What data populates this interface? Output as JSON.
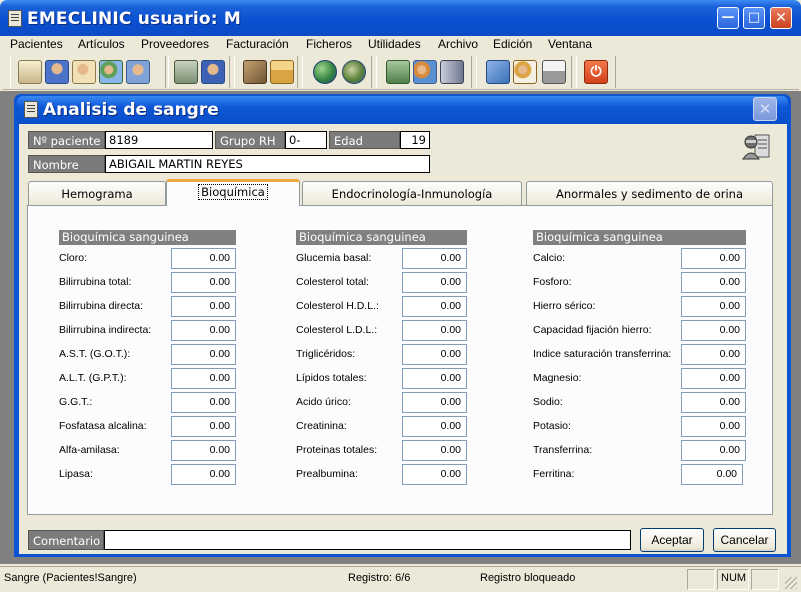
{
  "app": {
    "title": "EMECLINIC usuario: M"
  },
  "menu": [
    "Pacientes",
    "Artículos",
    "Proveedores",
    "Facturación",
    "Ficheros",
    "Utilidades",
    "Archivo",
    "Edición",
    "Ventana"
  ],
  "toolbar_icons": [
    "calendar-icon",
    "patient-icon",
    "patient-card-icon",
    "patients-group-icon",
    "patient-search-icon",
    "clipboard-icon",
    "doctor-icon",
    "books-icon",
    "home-icon",
    "globe-icon",
    "globe-world-icon",
    "cash-register-icon",
    "people-computer-icon",
    "server-icon",
    "notebook-icon",
    "mail-people-icon",
    "printer-icon",
    "power-icon"
  ],
  "dialog": {
    "title": "Analisis de sangre",
    "patient_no_label": "Nº paciente",
    "patient_no": "8189",
    "grupo_rh_label": "Grupo RH",
    "grupo_rh": "0-",
    "edad_label": "Edad",
    "edad": "19",
    "nombre_label": "Nombre",
    "nombre": "ABIGAIL MARTIN REYES"
  },
  "tabs": [
    "Hemograma",
    "Bioquímica",
    "Endocrinología-Inmunología",
    "Anormales y sedimento de orina"
  ],
  "columns": [
    {
      "header": "Bioquímica sanguinea",
      "rows": [
        {
          "label": "Cloro:",
          "value": "0.00"
        },
        {
          "label": "Bilirrubina total:",
          "value": "0.00"
        },
        {
          "label": "Bilirrubina directa:",
          "value": "0.00"
        },
        {
          "label": "Bilirrubina indirecta:",
          "value": "0.00"
        },
        {
          "label": "A.S.T. (G.O.T.):",
          "value": "0.00"
        },
        {
          "label": "A.L.T. (G.P.T.):",
          "value": "0.00"
        },
        {
          "label": "G.G.T.:",
          "value": "0.00"
        },
        {
          "label": "Fosfatasa alcalina:",
          "value": "0.00"
        },
        {
          "label": "Alfa-amilasa:",
          "value": "0.00"
        },
        {
          "label": "Lipasa:",
          "value": "0.00"
        }
      ]
    },
    {
      "header": "Bioquímica sanguinea",
      "rows": [
        {
          "label": "Glucemia basal:",
          "value": "0.00"
        },
        {
          "label": "Colesterol total:",
          "value": "0.00"
        },
        {
          "label": "Colesterol H.D.L.:",
          "value": "0.00"
        },
        {
          "label": "Colesterol L.D.L.:",
          "value": "0.00"
        },
        {
          "label": "Triglicéridos:",
          "value": "0.00"
        },
        {
          "label": "Lípidos totales:",
          "value": "0.00"
        },
        {
          "label": "Acido úrico:",
          "value": "0.00"
        },
        {
          "label": "Creatinina:",
          "value": "0.00"
        },
        {
          "label": "Proteinas totales:",
          "value": "0.00"
        },
        {
          "label": "Prealbumina:",
          "value": "0.00"
        }
      ]
    },
    {
      "header": "Bioquímica sanguinea",
      "rows": [
        {
          "label": "Calcio:",
          "value": "0.00"
        },
        {
          "label": "Fosforo:",
          "value": "0.00"
        },
        {
          "label": "Hierro sérico:",
          "value": "0.00"
        },
        {
          "label": "Capacidad fijación hierro:",
          "value": "0.00"
        },
        {
          "label": "Indice saturación transferrina:",
          "value": "0.00"
        },
        {
          "label": "Magnesio:",
          "value": "0.00"
        },
        {
          "label": "Sodio:",
          "value": "0.00"
        },
        {
          "label": "Potasio:",
          "value": "0.00"
        },
        {
          "label": "Transferrina:",
          "value": "0.00"
        },
        {
          "label": "Ferritina:",
          "value": "0.00"
        }
      ]
    }
  ],
  "comment": {
    "label": "Comentario",
    "value": ""
  },
  "buttons": {
    "accept": "Aceptar",
    "cancel": "Cancelar"
  },
  "statusbar": {
    "left": "Sangre (Pacientes!Sangre)",
    "registro": "Registro: 6/6",
    "bloqueado": "Registro bloqueado",
    "num": "NUM"
  },
  "colors": {
    "titlebar": "#0a4fd0",
    "label_bg": "#7b7b7b",
    "tab_highlight": "#f0a83d",
    "exit_icon": "#e8521e"
  }
}
